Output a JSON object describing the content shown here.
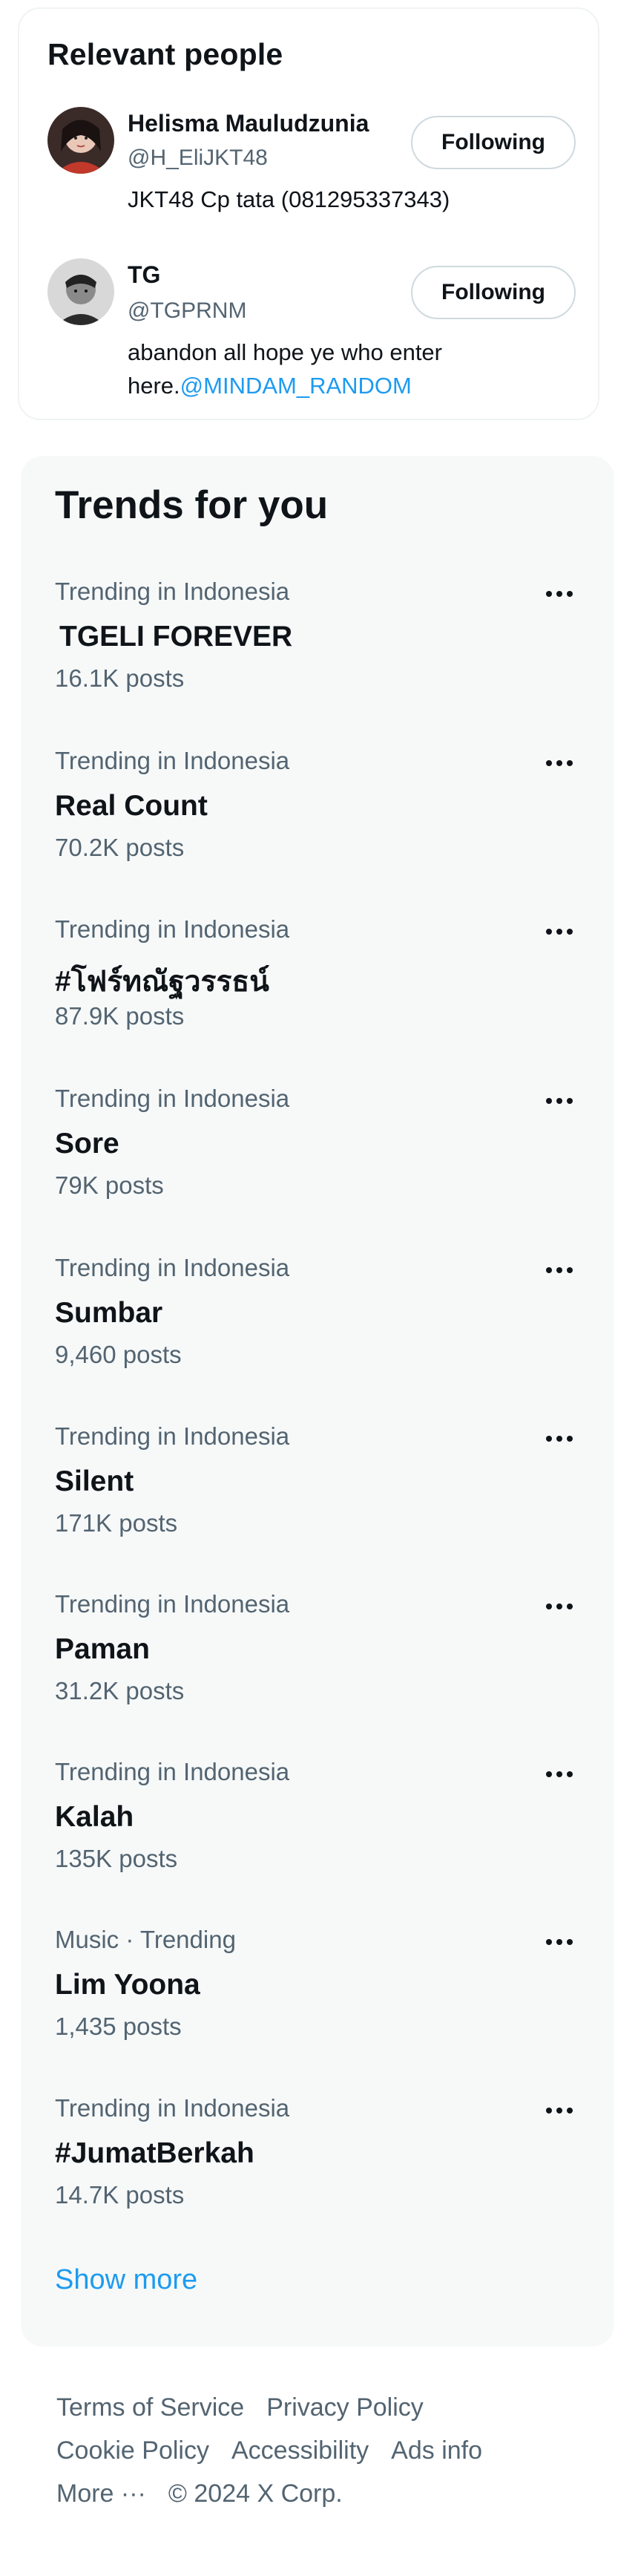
{
  "relevant_people": {
    "title": "Relevant people",
    "people": [
      {
        "name": "Helisma Mauludzunia",
        "handle": "@H_EliJKT48",
        "bio": "JKT48 Cp tata (081295337343)",
        "bio_mention": "",
        "follow_label": "Following"
      },
      {
        "name": "TG",
        "handle": "@TGPRNM",
        "bio": "abandon all hope ye who enter here.",
        "bio_mention": "@MINDAM_RANDOM",
        "follow_label": "Following"
      }
    ]
  },
  "trends": {
    "title": "Trends for you",
    "items": [
      {
        "context": "Trending in Indonesia",
        "name": "TGELI FOREVER",
        "count": "16.1K posts"
      },
      {
        "context": "Trending in Indonesia",
        "name": "Real Count",
        "count": "70.2K posts"
      },
      {
        "context": "Trending in Indonesia",
        "name": "#โฟร์ทณัฐวรรธน์",
        "count": "87.9K posts"
      },
      {
        "context": "Trending in Indonesia",
        "name": "Sore",
        "count": "79K posts"
      },
      {
        "context": "Trending in Indonesia",
        "name": "Sumbar",
        "count": "9,460 posts"
      },
      {
        "context": "Trending in Indonesia",
        "name": "Silent",
        "count": "171K posts"
      },
      {
        "context": "Trending in Indonesia",
        "name": "Paman",
        "count": "31.2K posts"
      },
      {
        "context": "Trending in Indonesia",
        "name": "Kalah",
        "count": "135K posts"
      },
      {
        "context": "Music · Trending",
        "name": "Lim Yoona",
        "count": "1,435 posts"
      },
      {
        "context": "Trending in Indonesia",
        "name": "#JumatBerkah",
        "count": "14.7K posts"
      }
    ],
    "show_more": "Show more"
  },
  "footer": {
    "terms": "Terms of Service",
    "privacy": "Privacy Policy",
    "cookie": "Cookie Policy",
    "accessibility": "Accessibility",
    "ads_info": "Ads info",
    "more": "More ···",
    "copyright": "© 2024 X Corp."
  },
  "colors": {
    "accent": "#1d9bf0",
    "secondary_text": "#536471",
    "trends_bg": "#f7f9f9"
  }
}
